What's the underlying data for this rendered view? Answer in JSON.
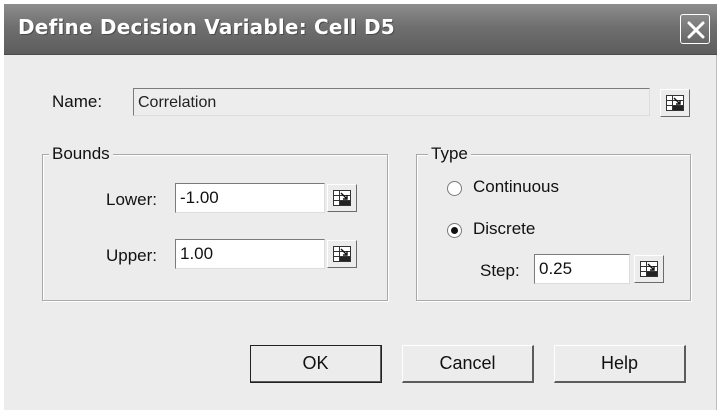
{
  "dialog": {
    "title": "Define Decision Variable: Cell D5"
  },
  "name_row": {
    "label": "Name:",
    "value": "Correlation"
  },
  "bounds": {
    "group_label": "Bounds",
    "lower_label": "Lower:",
    "lower_value": "-1.00",
    "upper_label": "Upper:",
    "upper_value": "1.00"
  },
  "type": {
    "group_label": "Type",
    "options": [
      {
        "label": "Continuous",
        "selected": false
      },
      {
        "label": "Discrete",
        "selected": true
      }
    ],
    "step_label": "Step:",
    "step_value": "0.25"
  },
  "buttons": {
    "ok": "OK",
    "cancel": "Cancel",
    "help": "Help"
  },
  "icons": {
    "close": "close-icon",
    "cell_reference": "cell-reference-icon"
  }
}
